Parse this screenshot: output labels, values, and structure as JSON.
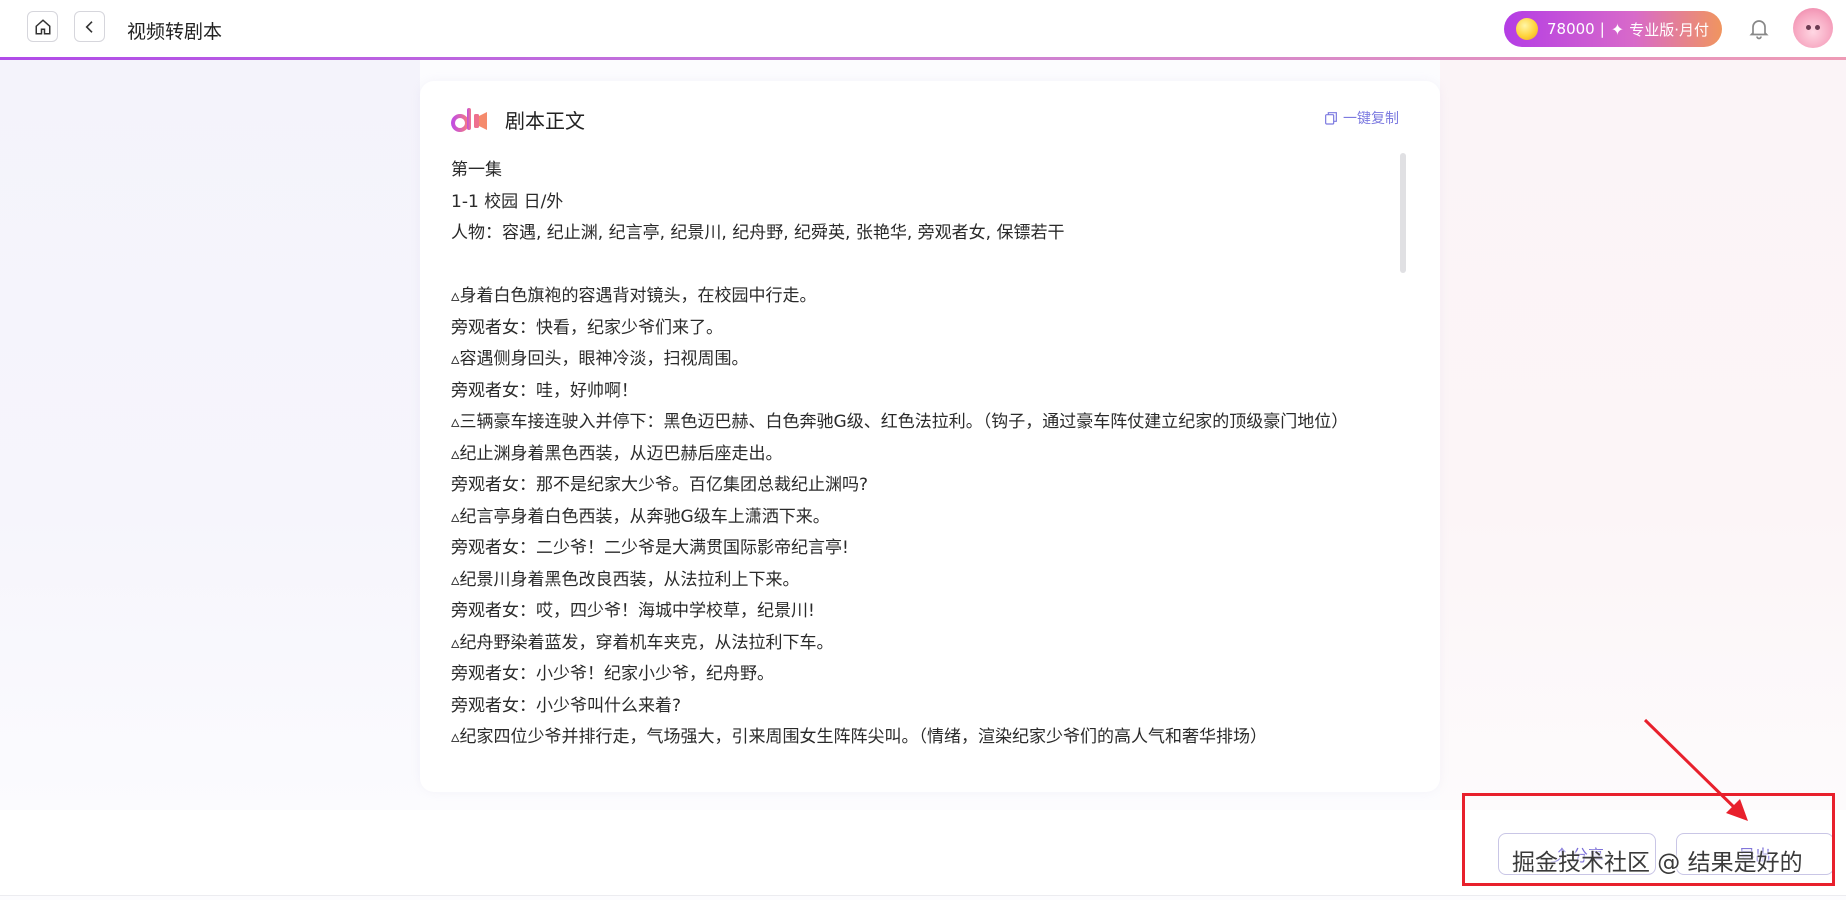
{
  "header": {
    "title": "视频转剧本",
    "points": "78000",
    "separator": "|",
    "plan": "专业版·月付",
    "colors": {
      "pill_start": "#b43de5",
      "pill_end": "#f0955f",
      "accent_line": "#b04be8"
    }
  },
  "card": {
    "title": "剧本正文",
    "copy_label": "一键复制",
    "lines": [
      "第一集",
      "1-1 校园 日/外",
      "人物：容遇, 纪止渊, 纪言亭, 纪景川, 纪舟野, 纪舜英, 张艳华, 旁观者女, 保镖若干",
      "",
      "▵身着白色旗袍的容遇背对镜头，在校园中行走。",
      "旁观者女：快看，纪家少爷们来了。",
      "▵容遇侧身回头，眼神冷淡，扫视周围。",
      "旁观者女：哇，好帅啊！",
      "▵三辆豪车接连驶入并停下：黑色迈巴赫、白色奔驰G级、红色法拉利。（钩子，通过豪车阵仗建立纪家的顶级豪门地位）",
      "▵纪止渊身着黑色西装，从迈巴赫后座走出。",
      "旁观者女：那不是纪家大少爷。百亿集团总裁纪止渊吗?",
      "▵纪言亭身着白色西装，从奔驰G级车上潇洒下来。",
      "旁观者女：二少爷！二少爷是大满贯国际影帝纪言亭!",
      "▵纪景川身着黑色改良西装，从法拉利上下来。",
      "旁观者女：哎，四少爷！海城中学校草，纪景川!",
      "▵纪舟野染着蓝发，穿着机车夹克，从法拉利下车。",
      "旁观者女：小少爷！纪家小少爷，纪舟野。",
      "旁观者女：小少爷叫什么来着?",
      "▵纪家四位少爷并排行走，气场强大，引来周围女生阵阵尖叫。（情绪，渲染纪家少爷们的高人气和奢华排场）"
    ]
  },
  "actions": {
    "share_label": "分享",
    "export_label": "导出"
  },
  "watermark": "掘金技术社区 @ 结果是好的"
}
